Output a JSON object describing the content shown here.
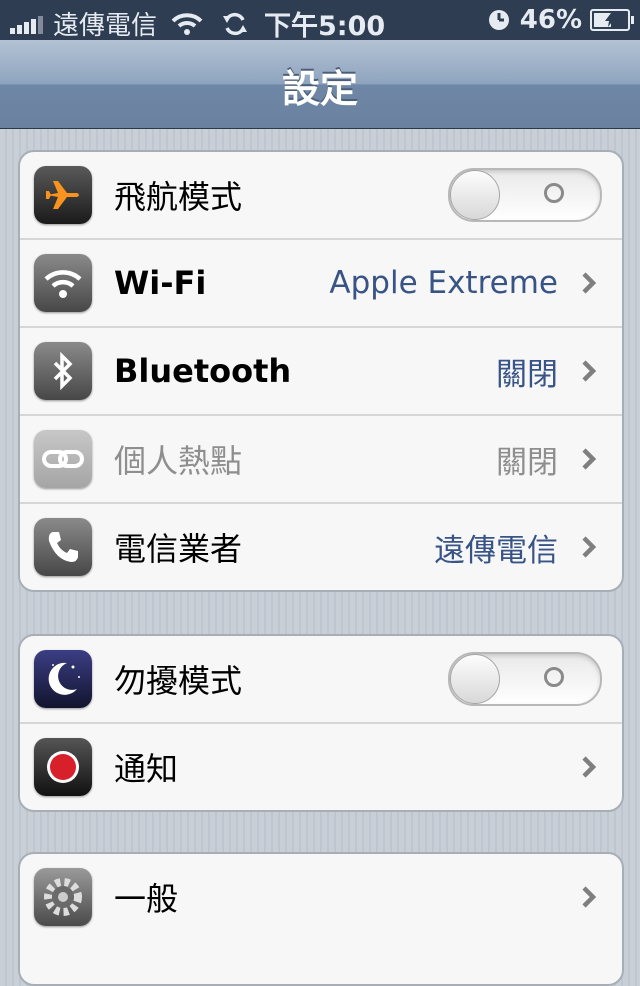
{
  "status": {
    "carrier": "遠傳電信",
    "time": "下午5:00",
    "battery": "46%",
    "battery_level": 0.46
  },
  "navbar": {
    "title": "設定"
  },
  "groups": [
    {
      "rows": [
        {
          "label": "飛航模式",
          "type": "toggle",
          "on": false,
          "icon": "airplane-icon"
        },
        {
          "label": "Wi-Fi",
          "value": "Apple Extreme",
          "type": "link",
          "icon": "wifi-icon"
        },
        {
          "label": "Bluetooth",
          "value": "關閉",
          "type": "link",
          "icon": "bluetooth-icon"
        },
        {
          "label": "個人熱點",
          "value": "關閉",
          "type": "link",
          "disabled": true,
          "icon": "hotspot-icon"
        },
        {
          "label": "電信業者",
          "value": "遠傳電信",
          "type": "link",
          "icon": "phone-icon"
        }
      ]
    },
    {
      "rows": [
        {
          "label": "勿擾模式",
          "type": "toggle",
          "on": false,
          "icon": "moon-icon"
        },
        {
          "label": "通知",
          "type": "link",
          "icon": "notification-icon"
        }
      ]
    },
    {
      "rows": [
        {
          "label": "一般",
          "type": "link",
          "icon": "gear-icon"
        }
      ]
    }
  ],
  "colors": {
    "status_bar": "#2e3d52",
    "value_blue": "#385487",
    "airplane_orange": "#f7931e",
    "notification_red": "#d8202a"
  }
}
